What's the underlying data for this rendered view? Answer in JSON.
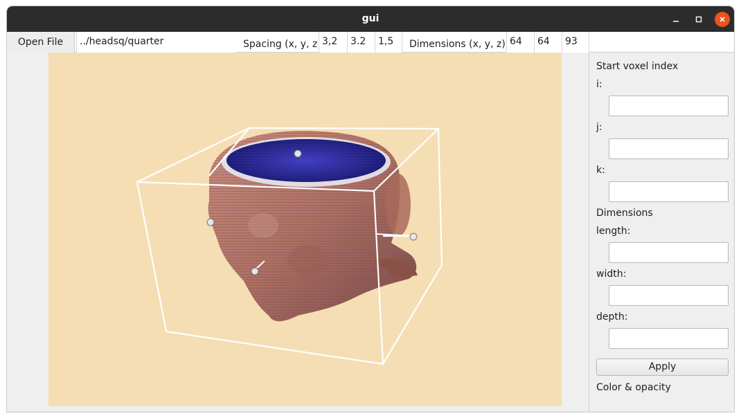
{
  "window": {
    "title": "gui"
  },
  "toolbar": {
    "open_file_label": "Open File",
    "file_path": "../headsq/quarter",
    "spacing_label": "Spacing (x, y, z):",
    "spacing": [
      "3,2",
      "3.2",
      "1,5"
    ],
    "dimensions_label": "Dimensions (x, y, z):",
    "dimensions": [
      "64",
      "64",
      "93"
    ]
  },
  "sidebar": {
    "start_voxel_label": "Start voxel index",
    "i_label": "i:",
    "j_label": "j:",
    "k_label": "k:",
    "dimensions_label": "Dimensions",
    "length_label": "length:",
    "width_label": "width:",
    "depth_label": "depth:",
    "inputs": {
      "i": "",
      "j": "",
      "k": "",
      "length": "",
      "width": "",
      "depth": ""
    },
    "apply_label": "Apply",
    "color_opacity_label": "Color & opacity"
  },
  "viewport": {
    "background_color": "#f5deb4",
    "volume_color": "#b97a67",
    "top_color": "#2a2a9e",
    "box_color": "#ffffff"
  }
}
